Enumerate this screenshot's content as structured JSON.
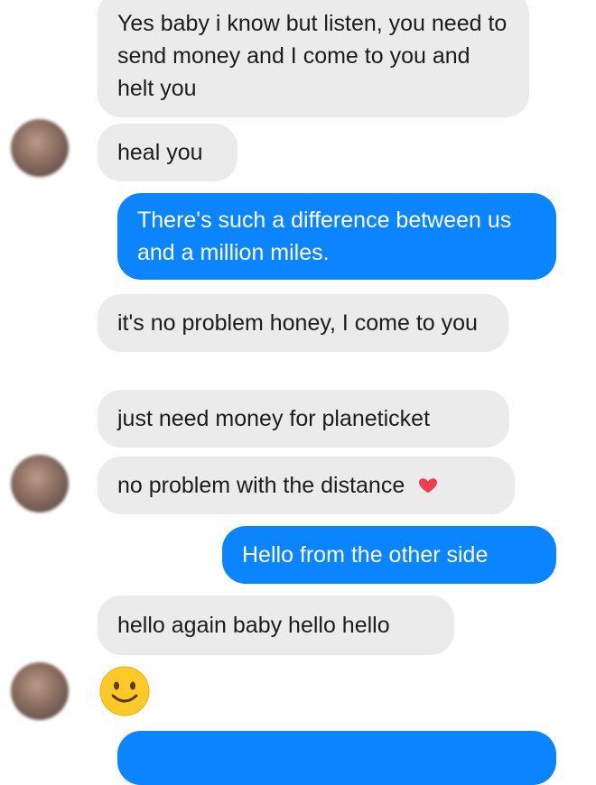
{
  "messages": [
    {
      "side": "received",
      "text": "Yes baby i know but listen, you need to send money and I come to you and helt you"
    },
    {
      "side": "received",
      "text": "heal you"
    },
    {
      "side": "sent",
      "text": "There's such a difference between us and a million miles."
    },
    {
      "side": "received",
      "text": "it's no problem honey, I come to you"
    },
    {
      "side": "received",
      "text": "just need money for planeticket"
    },
    {
      "side": "received",
      "text": "no problem with the distance",
      "icon": "red-heart-emoji-icon"
    },
    {
      "side": "sent",
      "text": "Hello from the other side"
    },
    {
      "side": "received",
      "text": "hello again baby hello hello"
    },
    {
      "side": "received",
      "text": "",
      "icon": "smiley-face-emoji-icon"
    }
  ],
  "colors": {
    "sent_bubble": "#0b84ff",
    "received_bubble": "#ebebeb",
    "heart": "#f03c4c",
    "emoji": "#ffc928"
  },
  "avatar": {
    "icon": "blurred-profile-photo"
  }
}
